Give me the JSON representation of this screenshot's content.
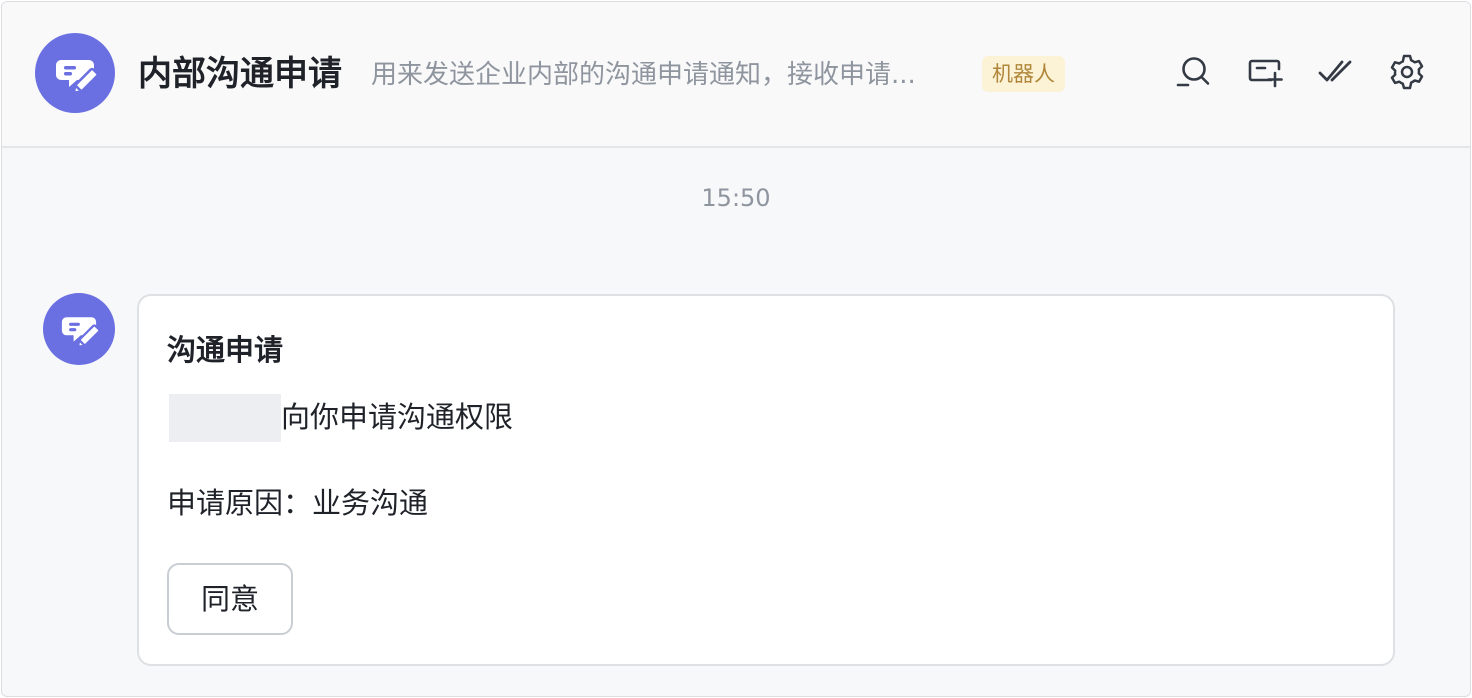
{
  "header": {
    "title": "内部沟通申请",
    "description": "用来发送企业内部的沟通申请通知，接收申请...",
    "bot_tag": "机器人",
    "avatar_icon": "chat-edit-icon",
    "toolbar": [
      {
        "icon": "search-icon"
      },
      {
        "icon": "add-window-icon"
      },
      {
        "icon": "double-check-icon"
      },
      {
        "icon": "settings-gear-icon"
      }
    ]
  },
  "chat": {
    "timestamp": "15:50",
    "message": {
      "avatar_icon": "chat-edit-icon",
      "card": {
        "title": "沟通申请",
        "request_text": "向你申请沟通权限",
        "reason_text": "申请原因：业务沟通",
        "agree_label": "同意"
      }
    }
  },
  "colors": {
    "avatar_bg": "#6a6fe1",
    "bot_tag_bg": "#fcf2d6",
    "bot_tag_text": "#b0873a",
    "header_bg": "#f9f9fa",
    "chat_bg": "#f7f8fa"
  }
}
